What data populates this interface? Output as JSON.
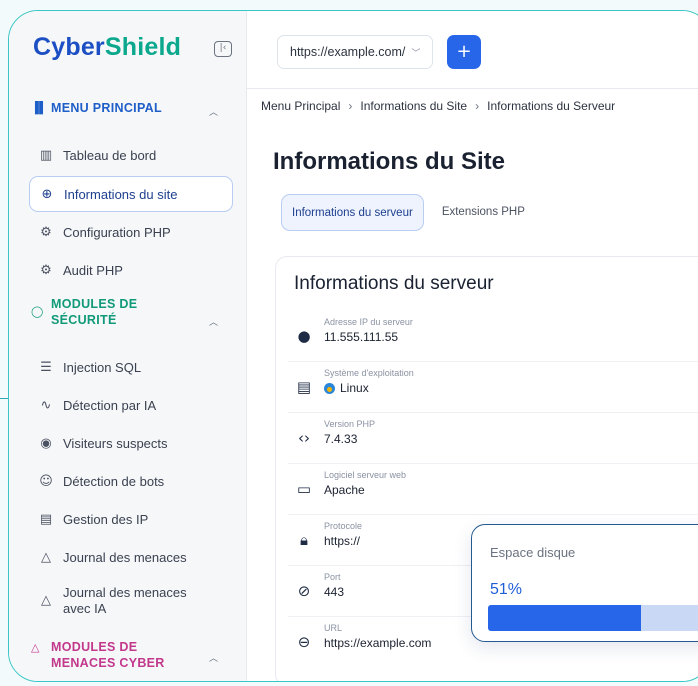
{
  "brand": {
    "part1": "Cyber",
    "part2": "Shield"
  },
  "sidebar": {
    "main_section": "MENU PRINCIPAL",
    "main_items": [
      {
        "label": "Tableau de bord",
        "icon": "bar-chart-icon"
      },
      {
        "label": "Informations du site",
        "icon": "globe-icon",
        "active": true
      },
      {
        "label": "Configuration PHP",
        "icon": "cog-icon"
      },
      {
        "label": "Audit PHP",
        "icon": "cog-icon"
      }
    ],
    "security_section_line1": "MODULES DE",
    "security_section_line2": "SÉCURITÉ",
    "security_items": [
      {
        "label": "Injection SQL",
        "icon": "database-icon"
      },
      {
        "label": "Détection par IA",
        "icon": "pulse-icon"
      },
      {
        "label": "Visiteurs suspects",
        "icon": "eye-icon"
      },
      {
        "label": "Détection de bots",
        "icon": "bot-icon"
      },
      {
        "label": "Gestion des IP",
        "icon": "server-icon"
      },
      {
        "label": "Journal des menaces",
        "icon": "warning-icon"
      },
      {
        "label_line1": "Journal des menaces",
        "label_line2": "avec IA",
        "icon": "warning-icon"
      }
    ],
    "cyber_section_line1": "MODULES DE",
    "cyber_section_line2": "MENACES CYBER"
  },
  "topbar": {
    "url_value": "https://example.com/",
    "add_label": "+"
  },
  "breadcrumb": [
    "Menu Principal",
    "Informations du Site",
    "Informations du Serveur"
  ],
  "page_title": "Informations du Site",
  "tabs": [
    {
      "label": "Informations du serveur",
      "active": true
    },
    {
      "label": "Extensions PHP"
    }
  ],
  "server_card": {
    "title": "Informations du serveur",
    "rows": [
      {
        "label": "Adresse IP du serveur",
        "value": "11.555.111.55",
        "icon": "globe-icon"
      },
      {
        "label": "Système d'exploitation",
        "value": "Linux",
        "icon": "server-icon"
      },
      {
        "label": "Version PHP",
        "value": "7.4.33",
        "icon": "code-icon"
      },
      {
        "label": "Logiciel serveur web",
        "value": "Apache",
        "icon": "laptop-icon"
      },
      {
        "label": "Protocole",
        "value": "https://",
        "icon": "lock-icon"
      },
      {
        "label": "Port",
        "value": "443",
        "icon": "block-icon"
      },
      {
        "label": "URL",
        "value": "https://example.com",
        "icon": "link-icon"
      }
    ]
  },
  "disk": {
    "title": "Espace disque",
    "percent_label": "51%",
    "percent_value": 51
  },
  "colors": {
    "accent": "#2766e8",
    "brand_blue": "#1c4fc4",
    "brand_green": "#0ca88d",
    "frame": "#38c6c6"
  }
}
